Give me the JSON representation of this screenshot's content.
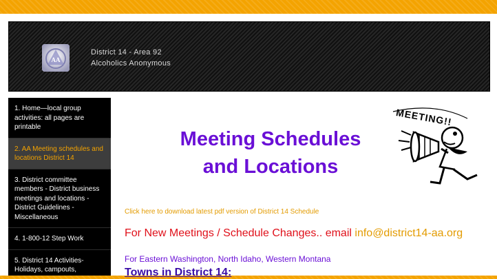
{
  "header": {
    "site_line1": "District 14 - Area 92",
    "site_line2": "Alcoholics Anonymous",
    "logo_icon": "aa-circle-triangle-logo"
  },
  "sidebar": {
    "items": [
      {
        "label": "1. Home—local group activities: all pages are printable",
        "active": false
      },
      {
        "label": "2. AA Meeting schedules and locations District 14",
        "active": true
      },
      {
        "label": "3. District committee members - District business meetings and locations - District Guidelines - Miscellaneous",
        "active": false
      },
      {
        "label": "4. 1-800-12 Step Work",
        "active": false
      },
      {
        "label": "5. District 14 Activities- Holidays, campouts,",
        "active": false
      }
    ]
  },
  "main": {
    "title_line1": "Meeting Schedules",
    "title_line2": "and Locations",
    "clipart_text": "MEETING!!",
    "clipart_icon": "megaphone-man-icon",
    "pdf_link": "Click here to download latest pdf version of District 14 Schedule",
    "changes_text": "For New Meetings / Schedule Changes.. email ",
    "email": "info@district14-aa.org",
    "region": "For Eastern Washington, North Idaho, Western Montana",
    "towns_heading": "Towns in District 14:"
  },
  "colors": {
    "frame_orange": "#f4a300",
    "title_purple": "#6a0fd6",
    "link_orange": "#e39b00",
    "alert_red": "#e0101a",
    "sidebar_bg": "#000000",
    "active_bg": "#3d3d3d"
  }
}
